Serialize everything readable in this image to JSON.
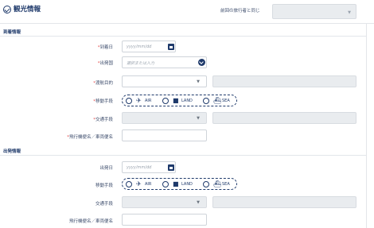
{
  "header": {
    "title": "観光情報",
    "same_as_label": "前回の旅行者と同じ",
    "same_as_value": ""
  },
  "arrival": {
    "section_title": "到着情報",
    "date_label": "到着日",
    "date_placeholder": "yyyy/mm/dd",
    "from_label": "出発国",
    "from_placeholder": "選択または入力",
    "purpose_label": "渡航目的",
    "transport_label": "移動手段",
    "options": [
      "AIR",
      "LAND",
      "SEA"
    ],
    "transit_label": "交通手段",
    "flight_label": "飛行機便名／車両便名"
  },
  "departure": {
    "section_title": "出発情報",
    "date_label": "出発日",
    "date_placeholder": "yyyy/mm/dd",
    "transport_label": "移動手段",
    "options": [
      "AIR",
      "LAND",
      "SEA"
    ],
    "transit_label": "交通手段",
    "flight_label": "飛行機便名／車両便名"
  },
  "icons": {
    "title": "check-circle-icon",
    "calendar": "calendar-icon",
    "dropdown": "chevron-down-icon",
    "air": "airplane-icon",
    "land": "car-icon",
    "sea": "ship-icon"
  },
  "colors": {
    "primary": "#1f3a6b",
    "required": "#e24a4a",
    "disabled_bg": "#e9ecef"
  }
}
